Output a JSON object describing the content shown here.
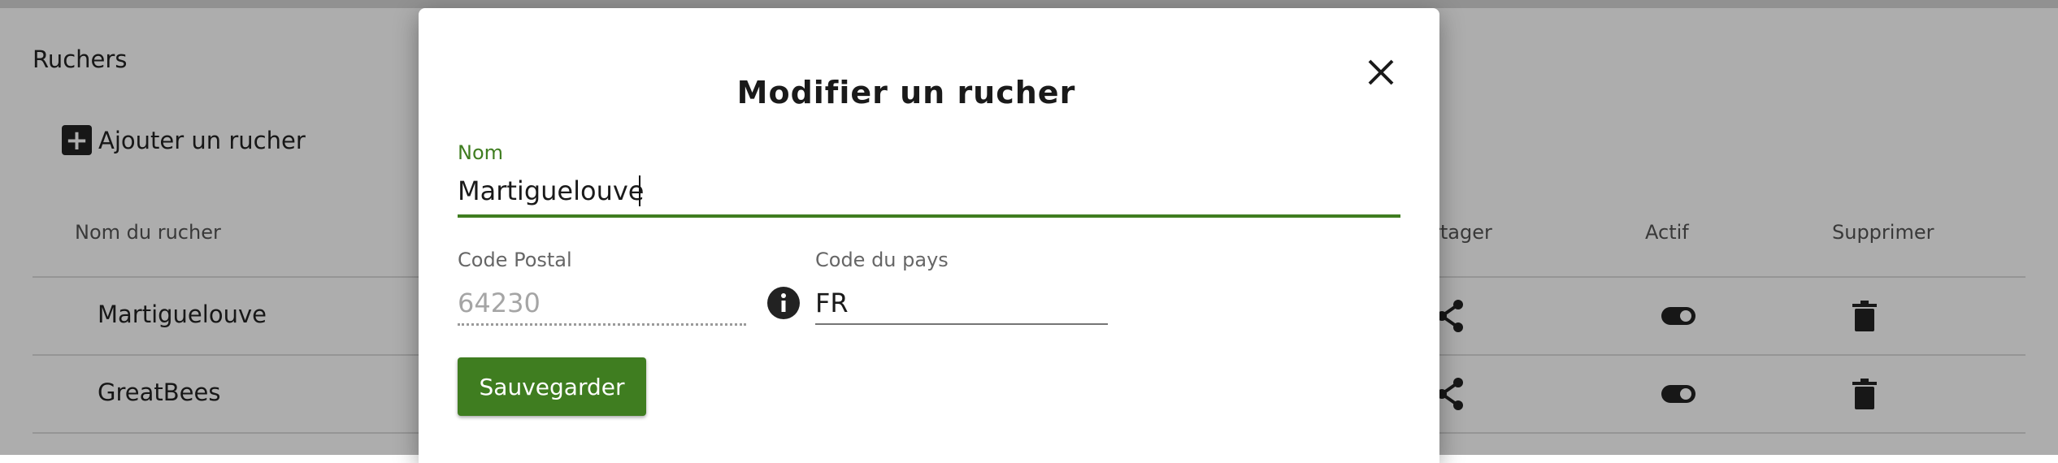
{
  "page": {
    "title": "Ruchers",
    "add_label": "Ajouter un rucher",
    "columns": [
      "Nom du rucher",
      "rtager",
      "Actif",
      "Supprimer"
    ],
    "rows": [
      {
        "name": "Martiguelouve"
      },
      {
        "name": "GreatBees"
      }
    ]
  },
  "dialog": {
    "title": "Modifier un rucher",
    "nom_label": "Nom",
    "nom_value": "Martiguelouve",
    "code_postal_label": "Code Postal",
    "code_postal_value": "64230",
    "code_pays_label": "Code du pays",
    "code_pays_value": "FR",
    "save_label": "Sauvegarder"
  },
  "icons": {
    "add": "plus-square-icon",
    "share": "share-icon",
    "toggle": "toggle-on-icon",
    "delete": "trash-icon",
    "close": "close-icon",
    "info": "info-icon"
  },
  "colors": {
    "accent": "#3f7d20",
    "overlay": "rgba(0,0,0,0.32)"
  }
}
